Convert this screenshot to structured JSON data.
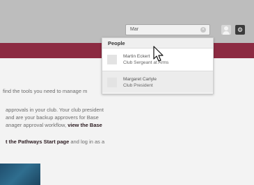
{
  "search": {
    "value": "Mar",
    "clear_glyph": "×"
  },
  "toolbar": {
    "settings_glyph": "⚙"
  },
  "dropdown": {
    "header": "People",
    "people": [
      {
        "name": "Martin Eckert",
        "role": "Club Sergeant at Arms"
      },
      {
        "name": "Margaret Carlyle",
        "role": "Club President"
      }
    ]
  },
  "content": {
    "line1": "find the tools you need to manage m",
    "line2": "approvals in your club. Your club president",
    "line3": "and are your backup approvers for Base",
    "line4_prefix": "anager approval workflow,",
    "line4_link": "view the Base",
    "line5_link": "t the Pathways Start page",
    "line5_suffix": "and log in as a"
  },
  "colors": {
    "header": "#bdbdbd",
    "nav": "#8c2b42",
    "content": "#f3f3f3"
  }
}
